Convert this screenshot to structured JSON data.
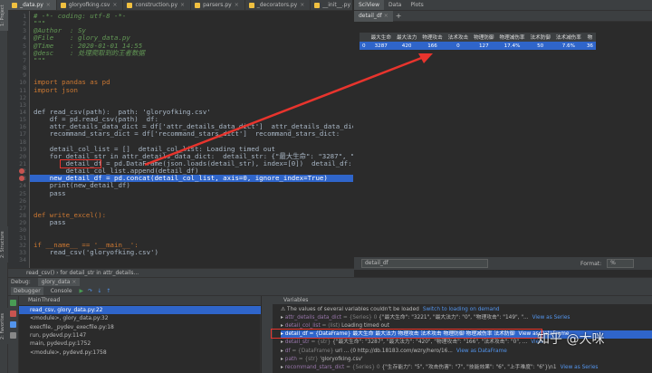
{
  "editor": {
    "tabs": [
      {
        "label": "_data.py",
        "active": true
      },
      {
        "label": "gloryofking.csv"
      },
      {
        "label": "construction.py"
      },
      {
        "label": "parsers.py"
      },
      {
        "label": "_decorators.py"
      },
      {
        "label": "__init__.py"
      }
    ],
    "lines": [
      {
        "n": "1",
        "text": "# -*- coding: utf-8 -*-"
      },
      {
        "n": "2",
        "text": "\"\"\""
      },
      {
        "n": "3",
        "text": "@Author  : Sy"
      },
      {
        "n": "4",
        "text": "@File    : glory_data.py"
      },
      {
        "n": "5",
        "text": "@Time    : 2020-01-01 14:55"
      },
      {
        "n": "6",
        "text": "@desc    : 处理爬取到的王者数据"
      },
      {
        "n": "7",
        "text": "\"\"\""
      },
      {
        "n": "8",
        "text": ""
      },
      {
        "n": "9",
        "text": ""
      },
      {
        "n": "10",
        "text": "import pandas as pd"
      },
      {
        "n": "11",
        "text": "import json"
      },
      {
        "n": "12",
        "text": ""
      },
      {
        "n": "13",
        "text": ""
      },
      {
        "n": "14",
        "text": "def read_csv(path):  path: 'gloryofking.csv'"
      },
      {
        "n": "15",
        "text": "    df = pd.read_csv(path)  df:"
      },
      {
        "n": "16",
        "text": "    attr_details_data_dict = df['attr_details_data_dict']  attr_details_data_dict"
      },
      {
        "n": "17",
        "text": "    recommand_stars_dict = df['recommand_stars_dict']  recommand_stars_dict:"
      },
      {
        "n": "18",
        "text": ""
      },
      {
        "n": "19",
        "text": "    detail_col_list = []  detail_col_list: Loading timed out"
      },
      {
        "n": "20",
        "text": "    for detail_str in attr_details_data_dict:  detail_str: {\"最大生命\": \"3287\", \"最"
      },
      {
        "n": "21",
        "text": "        detail_df = pd.DataFrame(json.loads(detail_str), index=[0])  detail_df:"
      },
      {
        "n": "22",
        "text": "        detail_col_list.append(detail_df)"
      },
      {
        "n": "23",
        "text": "    new_detail_df = pd.concat(detail_col_list, axis=0, ignore_index=True)"
      },
      {
        "n": "24",
        "text": "    print(new_detail_df)"
      },
      {
        "n": "25",
        "text": "    pass"
      },
      {
        "n": "26",
        "text": ""
      },
      {
        "n": "27",
        "text": ""
      },
      {
        "n": "28",
        "text": "def write_excel():"
      },
      {
        "n": "29",
        "text": "    pass"
      },
      {
        "n": "30",
        "text": ""
      },
      {
        "n": "31",
        "text": ""
      },
      {
        "n": "32",
        "text": "if __name__ == '__main__':"
      },
      {
        "n": "33",
        "text": "    read_csv('gloryofking.csv')"
      },
      {
        "n": "34",
        "text": ""
      }
    ],
    "breadcrumb": "read_csv()  ›  for detail_str in attr_details..."
  },
  "viewer": {
    "top_tabs": [
      "SciView",
      "Data",
      "Plots"
    ],
    "df_tab": "detail_df",
    "columns": [
      "",
      "最大生命",
      "最大法力",
      "物理攻击",
      "法术攻击",
      "物理防御",
      "物理减伤率",
      "法术防御",
      "法术减伤率",
      "物"
    ],
    "rows": [
      [
        "0",
        "3287",
        "420",
        "166",
        "0",
        "127",
        "17.4%",
        "50",
        "7.6%",
        "36"
      ]
    ],
    "expr_value": "detail_df",
    "format_label": "Format:",
    "format_value": "%"
  },
  "debug": {
    "title": "Debug:",
    "config": "glory_data",
    "tabs": [
      "Debugger",
      "Console"
    ],
    "thread": "MainThread",
    "frames": [
      {
        "text": "read_csv, glory_data.py:22",
        "selected": true
      },
      {
        "text": "<module>, glory_data.py:32"
      },
      {
        "text": "execfile, _pydev_execfile.py:18"
      },
      {
        "text": "run, pydevd.py:1147"
      },
      {
        "text": "main, pydevd.py:1752"
      },
      {
        "text": "<module>, pydevd.py:1758"
      }
    ],
    "variables_header": "Variables",
    "variables": [
      {
        "name": "The values of several variables couldn't be loaded",
        "type": "",
        "val": "",
        "link": "Switch to loading on demand"
      },
      {
        "name": "attr_details_data_dict",
        "type": " = {Series} 0",
        "val": "   {\"最大生命\": \"3221\", \"最大法力\": \"0\", \"物理攻击\": \"149\", \"...",
        "link": "View as Series"
      },
      {
        "name": "detail_col_list",
        "type": " = (list)",
        "val": " Loading timed out",
        "link": ""
      },
      {
        "name": "detail_df",
        "type": " = {DataFrame}",
        "val": "  最大生命  最大法力  物理攻击  法术攻击  物理防御  物理减伤率  法术防御",
        "link": "View as DataFrame",
        "selected": true
      },
      {
        "name": "detail_str",
        "type": " = {str}",
        "val": " {\"最大生命\": \"3287\", \"最大法力\": \"420\", \"物理攻击\": \"166\", \"法术攻击\": \"0\", ...",
        "link": "View"
      },
      {
        "name": "df",
        "type": " = {DataFrame}",
        "val": "                url  ...   (0    http://db.18183.com/wzry/hero/16...",
        "link": "View as DataFrame"
      },
      {
        "name": "path",
        "type": " = {str}",
        "val": " 'gloryofking.csv'",
        "link": ""
      },
      {
        "name": "recommand_stars_dict",
        "type": " = {Series} 0",
        "val": "   {\"生存能力\": \"5\", \"攻击伤害\": \"7\", \"技能效果\": \"6\", \"上手难度\": \"6\"}\\n1",
        "link": "View as Series"
      }
    ]
  },
  "watermark": "知乎 @大咪",
  "left_stripe": [
    "1: Project",
    "2: Structure",
    "2: Favorites"
  ]
}
